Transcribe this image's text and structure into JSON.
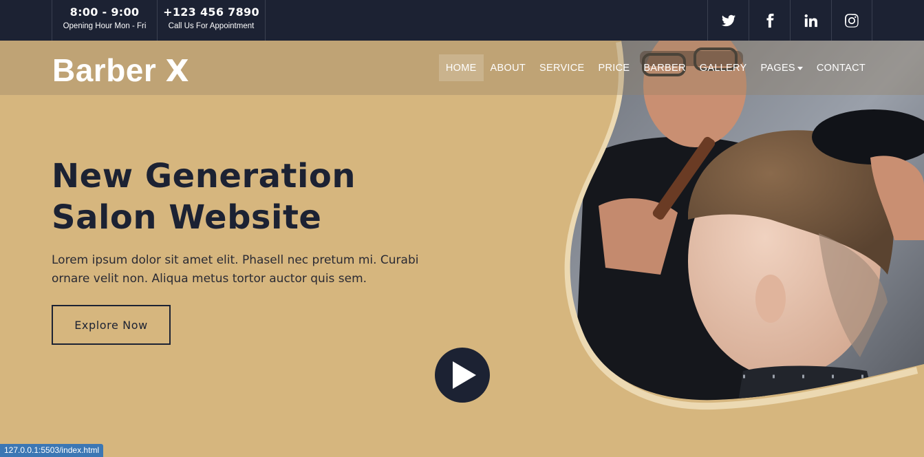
{
  "topbar": {
    "hours": {
      "time": "8:00 - 9:00",
      "label": "Opening Hour Mon - Fri"
    },
    "phone": {
      "number": "+123 456 7890",
      "label": "Call Us For Appointment"
    },
    "social": [
      "twitter-icon",
      "facebook-icon",
      "linkedin-icon",
      "instagram-icon"
    ]
  },
  "brand": {
    "name": "Barber",
    "mark": "X"
  },
  "nav": {
    "items": [
      "HOME",
      "ABOUT",
      "SERVICE",
      "PRICE",
      "BARBER",
      "GALLERY",
      "PAGES",
      "CONTACT"
    ],
    "active": "HOME"
  },
  "hero": {
    "title": "New Generation Salon Website",
    "text": "Lorem ipsum dolor sit amet elit. Phasell nec pretum mi. Curabi ornare velit non. Aliqua metus tortor auctor quis sem.",
    "button": "Explore Now",
    "play_icon": "play-icon"
  },
  "status_url": "127.0.0.1:5503/index.html",
  "colors": {
    "dark": "#1c2233",
    "accent": "#d6b67e"
  }
}
